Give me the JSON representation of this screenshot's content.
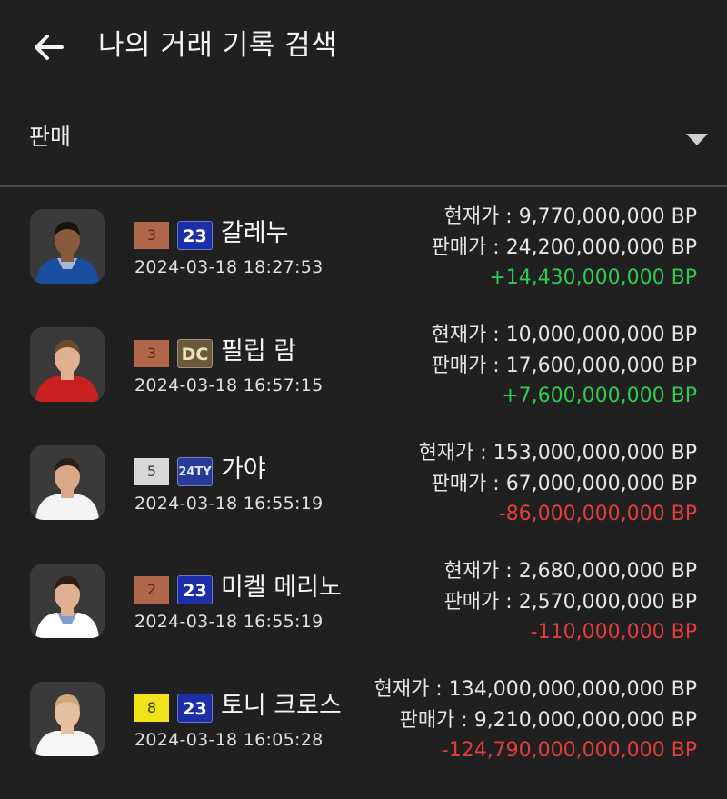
{
  "header": {
    "title": "나의 거래 기록 검색",
    "back_icon": "arrow-left-icon"
  },
  "filter": {
    "selected": "판매",
    "arrow_icon": "dropdown-triangle-icon"
  },
  "colors": {
    "background": "#202020",
    "positive": "#2ecc52",
    "negative": "#e43c3c",
    "divider": "#4a4a4a"
  },
  "records": [
    {
      "grade": "3",
      "grade_color": "#b0674a",
      "grade_text_color": "#5a2a1a",
      "season": "23",
      "season_bg": "#1a2fa8",
      "season_fg": "#ffffff",
      "name": "갈레누",
      "date": "2024-03-18 18:27:53",
      "current_label": "현재가 : ",
      "current": "9,770,000,000 BP",
      "sale_label": "판매가 : ",
      "sale": "24,200,000,000 BP",
      "diff": "+14,430,000,000 BP",
      "diff_sign": "pos",
      "jersey": "#1a4fa0",
      "jersey2": "#ffffff",
      "skin": "#8a5a3c",
      "hair": "#1a1410"
    },
    {
      "grade": "3",
      "grade_color": "#b0674a",
      "grade_text_color": "#5a2a1a",
      "season": "DC",
      "season_bg": "#6b5a3a",
      "season_fg": "#f0e2b8",
      "name": "필립 람",
      "date": "2024-03-18 16:57:15",
      "current_label": "현재가 : ",
      "current": "10,000,000,000 BP",
      "sale_label": "판매가 : ",
      "sale": "17,600,000,000 BP",
      "diff": "+7,600,000,000 BP",
      "diff_sign": "pos",
      "jersey": "#c82020",
      "jersey2": "#c82020",
      "skin": "#e0b090",
      "hair": "#6b4a2a"
    },
    {
      "grade": "5",
      "grade_color": "#d8d8d8",
      "grade_text_color": "#444444",
      "season": "24TY",
      "season_bg": "#2a3a9a",
      "season_fg": "#dfe6ff",
      "name": "가야",
      "date": "2024-03-18 16:55:19",
      "current_label": "현재가 : ",
      "current": "153,000,000,000 BP",
      "sale_label": "판매가 : ",
      "sale": "67,000,000,000 BP",
      "diff": "-86,000,000,000 BP",
      "diff_sign": "neg",
      "jersey": "#f4f4f4",
      "jersey2": "#f4f4f4",
      "skin": "#d8a888",
      "hair": "#2a1e16"
    },
    {
      "grade": "2",
      "grade_color": "#b0674a",
      "grade_text_color": "#5a2a1a",
      "season": "23",
      "season_bg": "#1a2fa8",
      "season_fg": "#ffffff",
      "name": "미켈 메리노",
      "date": "2024-03-18 16:55:19",
      "current_label": "현재가 : ",
      "current": "2,680,000,000 BP",
      "sale_label": "판매가 : ",
      "sale": "2,570,000,000 BP",
      "diff": "-110,000,000 BP",
      "diff_sign": "neg",
      "jersey": "#ffffff",
      "jersey2": "#2a5ab0",
      "skin": "#e0b090",
      "hair": "#2a1e16"
    },
    {
      "grade": "8",
      "grade_color": "#f2e21a",
      "grade_text_color": "#3a3400",
      "season": "23",
      "season_bg": "#1a2fa8",
      "season_fg": "#ffffff",
      "name": "토니 크로스",
      "date": "2024-03-18 16:05:28",
      "current_label": "현재가 : ",
      "current": "134,000,000,000,000 BP",
      "sale_label": "판매가 : ",
      "sale": "9,210,000,000,000 BP",
      "diff": "-124,790,000,000,000 BP",
      "diff_sign": "neg",
      "jersey": "#f6f6f6",
      "jersey2": "#f6f6f6",
      "skin": "#e8c0a0",
      "hair": "#c8a878"
    }
  ]
}
